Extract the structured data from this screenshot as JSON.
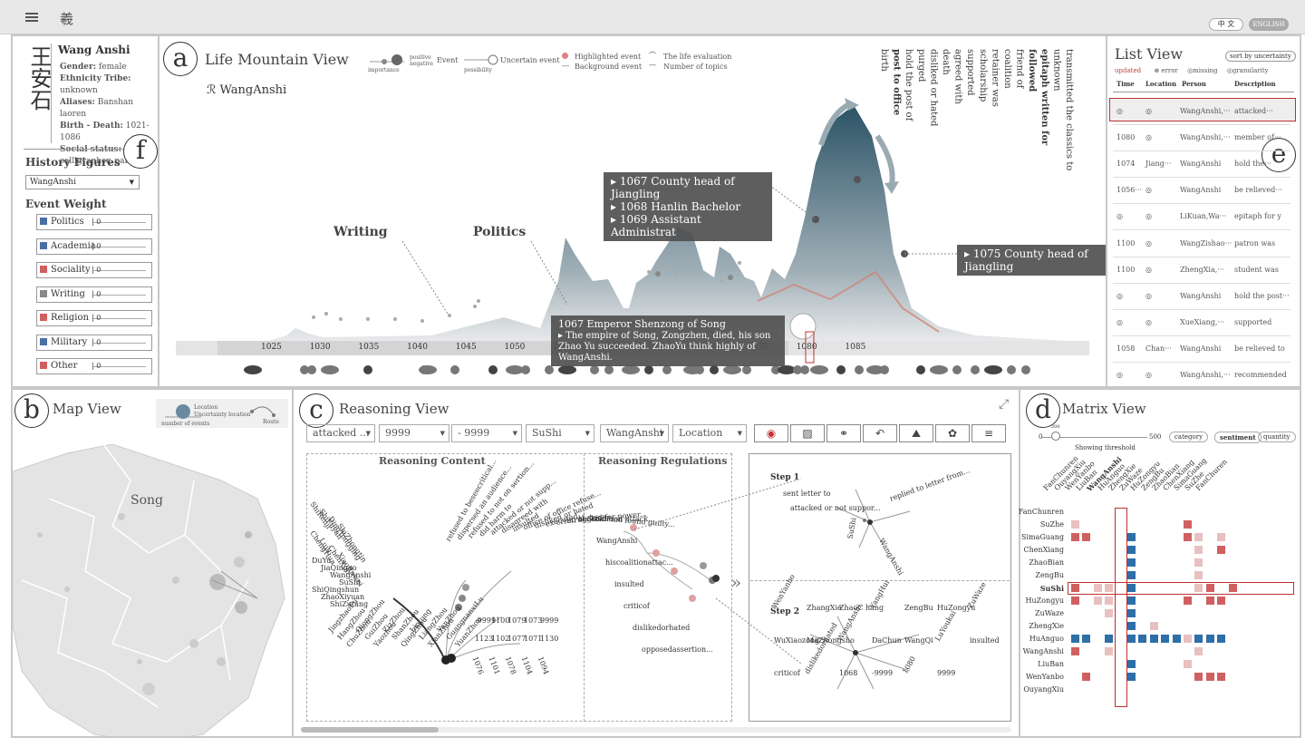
{
  "toolbar": {
    "lang_zh": "中 文",
    "lang_en": "ENGLISH"
  },
  "profile": {
    "name": "Wang Anshi",
    "gender_label": "Gender:",
    "gender": "female",
    "ethnicity_label": "Ethnicity Tribe:",
    "ethnicity": "unknown",
    "aliases_label": "Aliases:",
    "aliases": "Banshan laoren",
    "birth_label": "Birth - Death:",
    "birth": "1021-1086",
    "social_label": "Social status:",
    "social": "calligrapher, painter",
    "calligraphy": "王安石"
  },
  "history": {
    "title": "History Figures",
    "selected": "WangAnshi",
    "weight_title": "Event Weight",
    "weights": [
      {
        "label": "Politics",
        "color": "#4a6fa5"
      },
      {
        "label": "Academia",
        "color": "#4a6fa5"
      },
      {
        "label": "Sociality",
        "color": "#d06060"
      },
      {
        "label": "Writing",
        "color": "#888"
      },
      {
        "label": "Religion",
        "color": "#d06060"
      },
      {
        "label": "Military",
        "color": "#4a6fa5"
      },
      {
        "label": "Other",
        "color": "#d06060"
      }
    ]
  },
  "mountain": {
    "title": "Life Mountain View",
    "letter": "a",
    "person": "WangAnshi",
    "legend": {
      "positive": "positive",
      "negative": "negative",
      "event": "Event",
      "importance": "importance",
      "uncertain": "Uncertain event",
      "possibility": "possibility",
      "highlighted": "Highlighted event",
      "background": "Background event",
      "evaluation": "The life evaluation",
      "topics": "Number of topics"
    },
    "years": [
      "1025",
      "1030",
      "1035",
      "1040",
      "1045",
      "1050",
      "1055",
      "1060",
      "1065",
      "1070",
      "1075",
      "1080",
      "1085"
    ],
    "labels": {
      "writing": "Writing",
      "politics": "Politics"
    },
    "tip1": [
      "1067 County head of Jiangling",
      "1068 Hanlin Bachelor",
      "1069 Assistant Administrat"
    ],
    "tip2": "1075 County head of Jiangling",
    "tip3_title": "1067  Emperor Shenzong of Song",
    "tip3_body": "The empire of Song, Zongzhen, died, his son Zhao Yu succeeded. ZhaoYu think highly of WangAnshi.",
    "vwords": [
      "birth",
      "post to office",
      "hold the post of",
      "purged",
      "disliked or hated",
      "death",
      "agreed with",
      "supported",
      "scholarship",
      "retainer was",
      "coalition",
      "friend of",
      "followed",
      "epitaph written for",
      "unknown",
      "transmitted the classics to"
    ]
  },
  "list": {
    "title": "List View",
    "sort": "sort by uncertainty",
    "updated": "updated",
    "error": "error",
    "missing": "missing",
    "granularity": "granularity",
    "letter": "e",
    "cols": [
      "Time",
      "Location",
      "Person",
      "Description"
    ],
    "rows": [
      [
        "◎",
        "◎",
        "WangAnshi,···",
        "attacked···"
      ],
      [
        "1080",
        "◎",
        "WangAnshi,···",
        "member of···"
      ],
      [
        "1074",
        "Jiang···",
        "WangAnshi",
        "hold the···"
      ],
      [
        "1056···",
        "◎",
        "WangAnshi",
        "be relieved···"
      ],
      [
        "◎",
        "◎",
        "LiKuan,Wa···",
        "epitaph for y"
      ],
      [
        "1100",
        "◎",
        "WangZishao···",
        "patron was"
      ],
      [
        "1100",
        "◎",
        "ZhengXia,···",
        "student was"
      ],
      [
        "◎",
        "◎",
        "WangAnshi",
        "hold the post···"
      ],
      [
        "◎",
        "◎",
        "XueXiang,···",
        "supported"
      ],
      [
        "1058",
        "Chan···",
        "WangAnshi",
        "be relieved to"
      ],
      [
        "◎",
        "◎",
        "WangAnshi,···",
        "recommended"
      ]
    ]
  },
  "map": {
    "title": "Map View",
    "letter": "b",
    "region": "Song",
    "legend_location": "Location",
    "legend_uncertainty": "Uncertainty location",
    "legend_route": "Route",
    "legend_count": "number of events"
  },
  "reasoning": {
    "title": "Reasoning View",
    "letter": "c",
    "selects": [
      "attacked ...",
      "9999",
      "- 9999",
      "SuShi",
      "WangAnshi",
      "Location"
    ],
    "content_title": "Reasoning Content",
    "regulation_title": "Reasoning Regulations",
    "step1": "Step 1",
    "step2": "Step 2",
    "content_words": [
      "refused to beseecritical...",
      "dispersed an audience...",
      "refused to not on sertion...",
      "did harm to",
      "attacked or not supp...",
      "disagreed with",
      "insulted",
      "office of office refuse...",
      "disliked or hated",
      "executed",
      "critic of",
      "struggled for power...",
      "his coalition attack...",
      "tried and found guilty..."
    ],
    "people": [
      "ShiRenji",
      "ShiFuyan",
      "DingYongging",
      "ShiZhongtin",
      "ChengHua",
      "Luju",
      "ChenXun",
      "XiaoRuwei",
      "DuYu",
      "JiaQingao",
      "WangAnshi",
      "SuShi",
      "ShiQingshun",
      "ZhaoXiyuan",
      "ShiZutang"
    ],
    "places": [
      "JingzhaoFu",
      "HangZhou",
      "ChuZhou",
      "QiongZhou",
      "GuiZhou",
      "Yaozhou",
      "ZizZhou",
      "ShanZhou",
      "QingZhou",
      "Lintong",
      "LiangZhou",
      "XianZhou",
      "YanZhou",
      "GuangnanxiLu",
      "YuanZhou"
    ],
    "years": [
      "-9999",
      "1100",
      "1079",
      "1073",
      "9999",
      "1123",
      "1102",
      "1077",
      "1071",
      "1130",
      "1076",
      "1101",
      "1078",
      "1104",
      "1094"
    ],
    "reg_words": [
      "SuShi",
      "WangAnshi",
      "hiscoalitionattac...",
      "insulted",
      "criticof",
      "dislikedorhated",
      "opposedassertion..."
    ],
    "s1_words": [
      "sent letter to",
      "attacked or not suppor...",
      "replied to letter from...",
      "WangAnshi",
      "SuShi"
    ],
    "s2_words": [
      "WenYanbo",
      "ZhangXie",
      "ZhaoC hang",
      "YangHui",
      "ZengBu",
      "HuZongyu",
      "ZuWaze",
      "WuXiaozong",
      "MaZhongsho",
      "WangAnshi",
      "DaChun",
      "WangQi",
      "LuYoukai",
      "insulted",
      "criticof",
      "dislikedorhated",
      "1068",
      "-9999",
      "1080",
      "9999"
    ]
  },
  "matrix": {
    "title": "Matrix View",
    "letter": "d",
    "min": "0",
    "max": "500",
    "marker": "200",
    "threshold": "Showing threshold",
    "btn_category": "category",
    "btn_sentiment": "sentiment",
    "btn_quantity": "quantity",
    "cols": [
      "FanChunren",
      "OuyangXiu",
      "WenYanbo",
      "LiuBan",
      "WangAnshi",
      "HuAnguo",
      "ZhengXie",
      "ZuWaze",
      "HuZongyu",
      "ZengBu",
      "ZhaoBian",
      "ChenXiang",
      "SimaGuang",
      "SuZhe",
      "FanChuren"
    ],
    "rows": [
      "FanChunren",
      "SuZhe",
      "SimaGuang",
      "ChenXiang",
      "ZhaoBian",
      "ZengBu",
      "SuShi",
      "HuZongyu",
      "ZuWaze",
      "ZhengXie",
      "HuAnguo",
      "WangAnshi",
      "LiuBan",
      "WenYanbo",
      "OuyangXiu"
    ]
  }
}
